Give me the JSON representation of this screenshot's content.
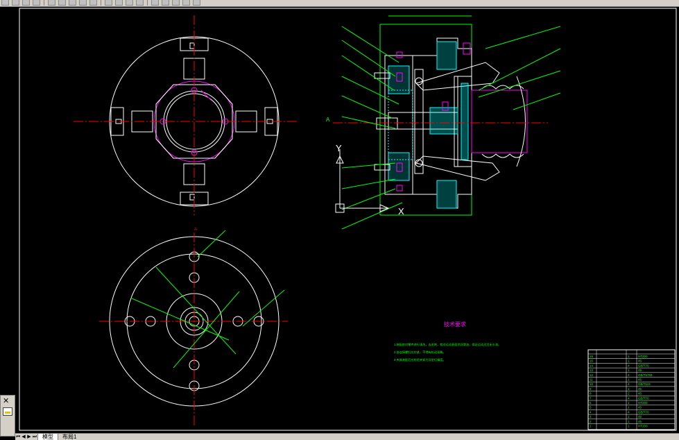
{
  "toolbar": {
    "buttons": [
      "new-icon",
      "open-icon",
      "save-icon",
      "plot-icon",
      "cut-icon",
      "copy-icon",
      "paste-icon",
      "undo-icon",
      "redo-icon",
      "pan-icon",
      "zoom-icon",
      "zoom-window-icon",
      "zoom-previous-icon",
      "properties-icon",
      "design-center-icon",
      "tool-palette-icon",
      "layer-icon",
      "help-icon"
    ]
  },
  "drawing": {
    "title": "技术要求",
    "requirements": [
      "1.装配前对零件进行清洗，去毛刺，相对运动表面涂润滑油，保证运动灵活无卡滞。",
      "2.各连接螺钉应拧紧，不得有松动现象。",
      "3.夹具装配后应检验夹紧力及定位精度。"
    ],
    "section_label": "A",
    "axis_y": "Y",
    "axis_x": "X",
    "view_label": "A",
    "colors": {
      "background": "#000000",
      "outline": "#ffffff",
      "centerline": "#ff0000",
      "dimension": "#00ff00",
      "highlight": "#ff00ff",
      "hatch": "#00ffff"
    }
  },
  "title_block": {
    "rows": [
      [
        "16",
        "",
        "1",
        "HT200"
      ],
      [
        "15",
        "",
        "1",
        "45"
      ],
      [
        "14",
        "",
        "4",
        "GB/T70"
      ],
      [
        "13",
        "",
        "1",
        "45"
      ],
      [
        "12",
        "",
        "4",
        "GB/T5783"
      ],
      [
        "11",
        "",
        "1",
        "45"
      ],
      [
        "10",
        "",
        "4",
        "GB/T119"
      ],
      [
        "9",
        "",
        "1",
        "45"
      ],
      [
        "8",
        "",
        "2",
        "45"
      ],
      [
        "7",
        "",
        "4",
        "GB/T70"
      ],
      [
        "6",
        "",
        "1",
        "HT200"
      ],
      [
        "5",
        "",
        "1",
        "45"
      ],
      [
        "4",
        "",
        "4",
        "GB/T70"
      ],
      [
        "3",
        "",
        "1",
        "45"
      ],
      [
        "2",
        "",
        "1",
        "45"
      ],
      [
        "1",
        "",
        "1",
        "HT200"
      ]
    ]
  },
  "status": {
    "tabs": [
      "模型",
      "布局1"
    ],
    "active_tab": "模型",
    "nav": [
      "⏮",
      "◀",
      "▶",
      "⏭"
    ]
  }
}
